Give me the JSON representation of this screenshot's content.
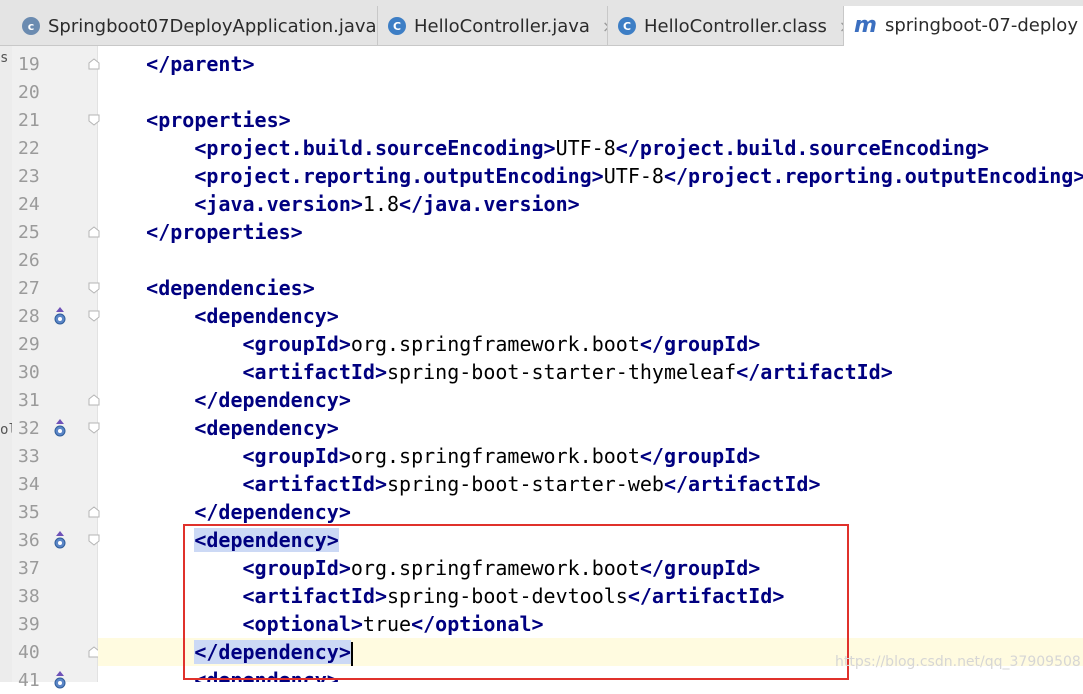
{
  "tabs": [
    {
      "label": "Springboot07DeployApplication.java",
      "icon": "spring-boot-class-icon",
      "close": "×"
    },
    {
      "label": "HelloController.java",
      "icon": "class-icon",
      "close": "×"
    },
    {
      "label": "HelloController.class",
      "icon": "class-icon",
      "close": "×"
    },
    {
      "label": "springboot-07-deploy",
      "icon": "maven-icon",
      "close": ""
    }
  ],
  "left_edge_fragments": [
    "s'",
    "ol"
  ],
  "editor": {
    "lines": [
      {
        "n": "19",
        "indent": "    ",
        "pre": "",
        "tag": "</parent>",
        "mid": "",
        "tag2": "",
        "marker": "",
        "fold": "end"
      },
      {
        "n": "20",
        "indent": "",
        "pre": "",
        "tag": "",
        "mid": "",
        "tag2": "",
        "marker": "",
        "fold": ""
      },
      {
        "n": "21",
        "indent": "    ",
        "pre": "",
        "tag": "<properties>",
        "mid": "",
        "tag2": "",
        "marker": "",
        "fold": "start"
      },
      {
        "n": "22",
        "indent": "        ",
        "pre": "",
        "tag": "<project.build.sourceEncoding>",
        "mid": "UTF-8",
        "tag2": "</project.build.sourceEncoding>",
        "marker": "",
        "fold": ""
      },
      {
        "n": "23",
        "indent": "        ",
        "pre": "",
        "tag": "<project.reporting.outputEncoding>",
        "mid": "UTF-8",
        "tag2": "</project.reporting.outputEncoding>",
        "marker": "",
        "fold": ""
      },
      {
        "n": "24",
        "indent": "        ",
        "pre": "",
        "tag": "<java.version>",
        "mid": "1.8",
        "tag2": "</java.version>",
        "marker": "",
        "fold": ""
      },
      {
        "n": "25",
        "indent": "    ",
        "pre": "",
        "tag": "</properties>",
        "mid": "",
        "tag2": "",
        "marker": "",
        "fold": "end"
      },
      {
        "n": "26",
        "indent": "",
        "pre": "",
        "tag": "",
        "mid": "",
        "tag2": "",
        "marker": "",
        "fold": ""
      },
      {
        "n": "27",
        "indent": "    ",
        "pre": "",
        "tag": "<dependencies>",
        "mid": "",
        "tag2": "",
        "marker": "",
        "fold": "start"
      },
      {
        "n": "28",
        "indent": "        ",
        "pre": "",
        "tag": "<dependency>",
        "mid": "",
        "tag2": "",
        "marker": "override",
        "fold": "start"
      },
      {
        "n": "29",
        "indent": "            ",
        "pre": "",
        "tag": "<groupId>",
        "mid": "org.springframework.boot",
        "tag2": "</groupId>",
        "marker": "",
        "fold": ""
      },
      {
        "n": "30",
        "indent": "            ",
        "pre": "",
        "tag": "<artifactId>",
        "mid": "spring-boot-starter-thymeleaf",
        "tag2": "</artifactId>",
        "marker": "",
        "fold": ""
      },
      {
        "n": "31",
        "indent": "        ",
        "pre": "",
        "tag": "</dependency>",
        "mid": "",
        "tag2": "",
        "marker": "",
        "fold": "end"
      },
      {
        "n": "32",
        "indent": "        ",
        "pre": "",
        "tag": "<dependency>",
        "mid": "",
        "tag2": "",
        "marker": "override",
        "fold": "start"
      },
      {
        "n": "33",
        "indent": "            ",
        "pre": "",
        "tag": "<groupId>",
        "mid": "org.springframework.boot",
        "tag2": "</groupId>",
        "marker": "",
        "fold": ""
      },
      {
        "n": "34",
        "indent": "            ",
        "pre": "",
        "tag": "<artifactId>",
        "mid": "spring-boot-starter-web",
        "tag2": "</artifactId>",
        "marker": "",
        "fold": ""
      },
      {
        "n": "35",
        "indent": "        ",
        "pre": "",
        "tag": "</dependency>",
        "mid": "",
        "tag2": "",
        "marker": "",
        "fold": "end"
      },
      {
        "n": "36",
        "indent": "        ",
        "pre": "",
        "tag": "<dependency>",
        "mid": "",
        "tag2": "",
        "marker": "override",
        "fold": "start",
        "hl": true
      },
      {
        "n": "37",
        "indent": "            ",
        "pre": "",
        "tag": "<groupId>",
        "mid": "org.springframework.boot",
        "tag2": "</groupId>",
        "marker": "",
        "fold": ""
      },
      {
        "n": "38",
        "indent": "            ",
        "pre": "",
        "tag": "<artifactId>",
        "mid": "spring-boot-devtools",
        "tag2": "</artifactId>",
        "marker": "",
        "fold": ""
      },
      {
        "n": "39",
        "indent": "            ",
        "pre": "",
        "tag": "<optional>",
        "mid": "true",
        "tag2": "</optional>",
        "marker": "",
        "fold": ""
      },
      {
        "n": "40",
        "indent": "        ",
        "pre": "",
        "tag": "</dependency>",
        "mid": "",
        "tag2": "",
        "marker": "",
        "fold": "end",
        "hl": true,
        "caret": true
      },
      {
        "n": "41",
        "indent": "        ",
        "pre": "",
        "tag": "<dependency>",
        "mid": "",
        "tag2": "",
        "marker": "override",
        "fold": ""
      }
    ]
  },
  "watermark": "https://blog.csdn.net/qq_37909508",
  "colors": {
    "tag": "#000080",
    "highlight_box": "#e0312b",
    "tag_highlight": "#ccd9f5",
    "caret_line": "#fffbe0"
  }
}
